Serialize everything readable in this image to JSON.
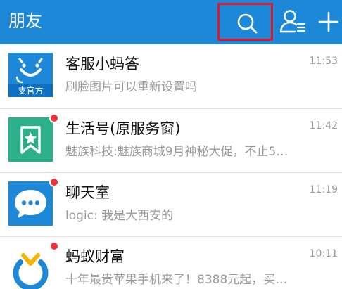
{
  "header": {
    "title": "朋友"
  },
  "conversations": [
    {
      "title": "客服小蚂答",
      "subtitle": "刷脸图片可以重新设置吗",
      "time": "11:53",
      "avatar_tag": "官方",
      "unread": false,
      "avatar_color": "#1e88d8"
    },
    {
      "title": "生活号(原服务窗)",
      "subtitle": "魅族科技:魅族商城9月神秘大促，不止5…",
      "time": "11:42",
      "unread": true,
      "avatar_color": "#2bb08a"
    },
    {
      "title": "聊天室",
      "subtitle": "logic: 我是大西安的",
      "time": "11:19",
      "unread": true,
      "avatar_color": "#1e88d8"
    },
    {
      "title": "蚂蚁财富",
      "subtitle": "十年最贵苹果手机来了！8388元起，买…",
      "time": "10:11",
      "unread": true,
      "avatar_color": "#ffffff"
    }
  ],
  "colors": {
    "header_bg": "#1e88d8",
    "highlight": "#e0182a",
    "unread_dot": "#f0323c"
  }
}
